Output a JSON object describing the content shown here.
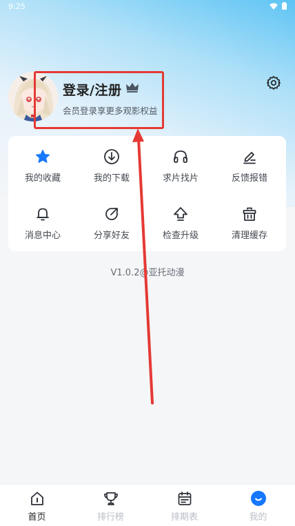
{
  "status_bar": {
    "time": "9:25"
  },
  "profile": {
    "title": "登录/注册",
    "subtitle": "会员登录享更多观影权益"
  },
  "menu": {
    "items": [
      {
        "label": "我的收藏",
        "icon": "star-icon"
      },
      {
        "label": "我的下载",
        "icon": "download-icon"
      },
      {
        "label": "求片找片",
        "icon": "headphones-icon"
      },
      {
        "label": "反馈报错",
        "icon": "edit-icon"
      },
      {
        "label": "消息中心",
        "icon": "bell-icon"
      },
      {
        "label": "分享好友",
        "icon": "share-icon"
      },
      {
        "label": "检查升级",
        "icon": "upgrade-icon"
      },
      {
        "label": "清理缓存",
        "icon": "trash-icon"
      }
    ]
  },
  "version": "V1.0.2@亚托动漫",
  "tabs": [
    {
      "label": "首页",
      "icon": "home-icon",
      "state": "selected"
    },
    {
      "label": "排行榜",
      "icon": "trophy-icon",
      "state": "normal"
    },
    {
      "label": "排期表",
      "icon": "calendar-icon",
      "state": "normal"
    },
    {
      "label": "我的",
      "icon": "profile-icon",
      "state": "current-page"
    }
  ],
  "colors": {
    "accent": "#1677ff",
    "highlight": "#e53935",
    "gradient_top": "#5ec4f4"
  }
}
